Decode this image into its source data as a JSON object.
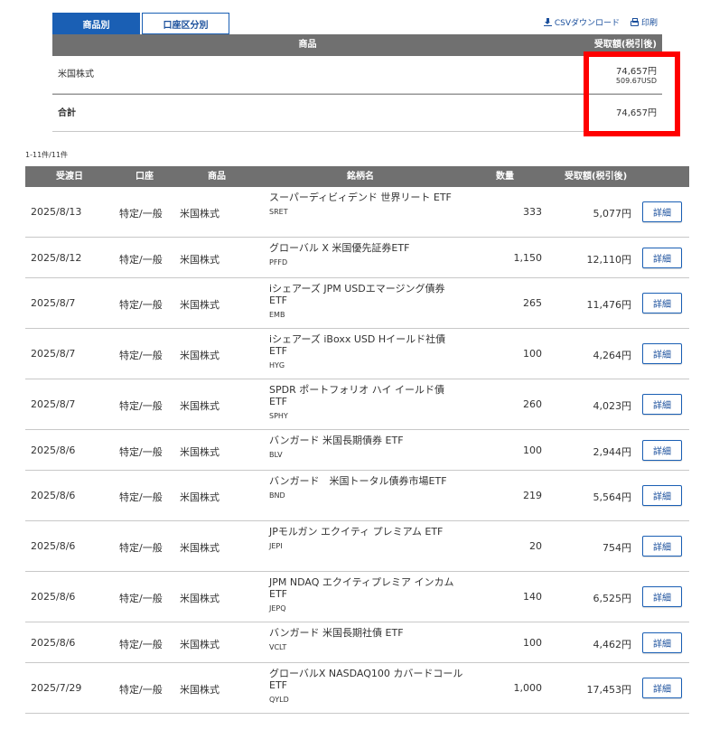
{
  "tabs": [
    {
      "label": "商品別",
      "active": true
    },
    {
      "label": "口座区分別",
      "active": false
    }
  ],
  "toplinks": {
    "csv": "CSVダウンロード",
    "print": "印刷"
  },
  "summary": {
    "headers": {
      "product": "商品",
      "amount": "受取額(税引後)"
    },
    "rows": [
      {
        "label": "米国株式",
        "amount": "74,657円",
        "sub": "509.67USD"
      }
    ],
    "total": {
      "label": "合計",
      "amount": "74,657円"
    }
  },
  "count": "1-11件/11件",
  "table": {
    "headers": {
      "date": "受渡日",
      "account": "口座",
      "product": "商品",
      "name": "銘柄名",
      "qty": "数量",
      "amount": "受取額(税引後)"
    },
    "detail_label": "詳細",
    "rows": [
      {
        "date": "2025/8/13",
        "account": "特定/一般",
        "product": "米国株式",
        "name": "スーパーディビィデンド 世界リート ETF",
        "code": "SRET",
        "qty": "333",
        "amount": "5,077円"
      },
      {
        "date": "2025/8/12",
        "account": "特定/一般",
        "product": "米国株式",
        "name": "グローバル X 米国優先証券ETF",
        "code": "PFFD",
        "qty": "1,150",
        "amount": "12,110円"
      },
      {
        "date": "2025/8/7",
        "account": "特定/一般",
        "product": "米国株式",
        "name": "iシェアーズ JPM USDエマージング債券 ETF",
        "code": "EMB",
        "qty": "265",
        "amount": "11,476円"
      },
      {
        "date": "2025/8/7",
        "account": "特定/一般",
        "product": "米国株式",
        "name": "iシェアーズ iBoxx USD Hイールド社債 ETF",
        "code": "HYG",
        "qty": "100",
        "amount": "4,264円"
      },
      {
        "date": "2025/8/7",
        "account": "特定/一般",
        "product": "米国株式",
        "name": "SPDR ポートフォリオ ハイ イールド債 ETF",
        "code": "SPHY",
        "qty": "260",
        "amount": "4,023円"
      },
      {
        "date": "2025/8/6",
        "account": "特定/一般",
        "product": "米国株式",
        "name": "バンガード 米国長期債券 ETF",
        "code": "BLV",
        "qty": "100",
        "amount": "2,944円"
      },
      {
        "date": "2025/8/6",
        "account": "特定/一般",
        "product": "米国株式",
        "name": "バンガード　米国トータル債券市場ETF",
        "code": "BND",
        "qty": "219",
        "amount": "5,564円"
      },
      {
        "date": "2025/8/6",
        "account": "特定/一般",
        "product": "米国株式",
        "name": "JPモルガン エクイティ プレミアム ETF",
        "code": "JEPI",
        "qty": "20",
        "amount": "754円"
      },
      {
        "date": "2025/8/6",
        "account": "特定/一般",
        "product": "米国株式",
        "name": "JPM NDAQ エクイティプレミア インカム ETF",
        "code": "JEPQ",
        "qty": "140",
        "amount": "6,525円"
      },
      {
        "date": "2025/8/6",
        "account": "特定/一般",
        "product": "米国株式",
        "name": "バンガード 米国長期社債 ETF",
        "code": "VCLT",
        "qty": "100",
        "amount": "4,462円"
      },
      {
        "date": "2025/7/29",
        "account": "特定/一般",
        "product": "米国株式",
        "name": "グローバルX NASDAQ100 カバードコールETF",
        "code": "QYLD",
        "qty": "1,000",
        "amount": "17,453円"
      }
    ]
  },
  "colors": {
    "accent": "#1a5fb4",
    "header_bg": "#707070",
    "highlight": "#ff0000"
  }
}
